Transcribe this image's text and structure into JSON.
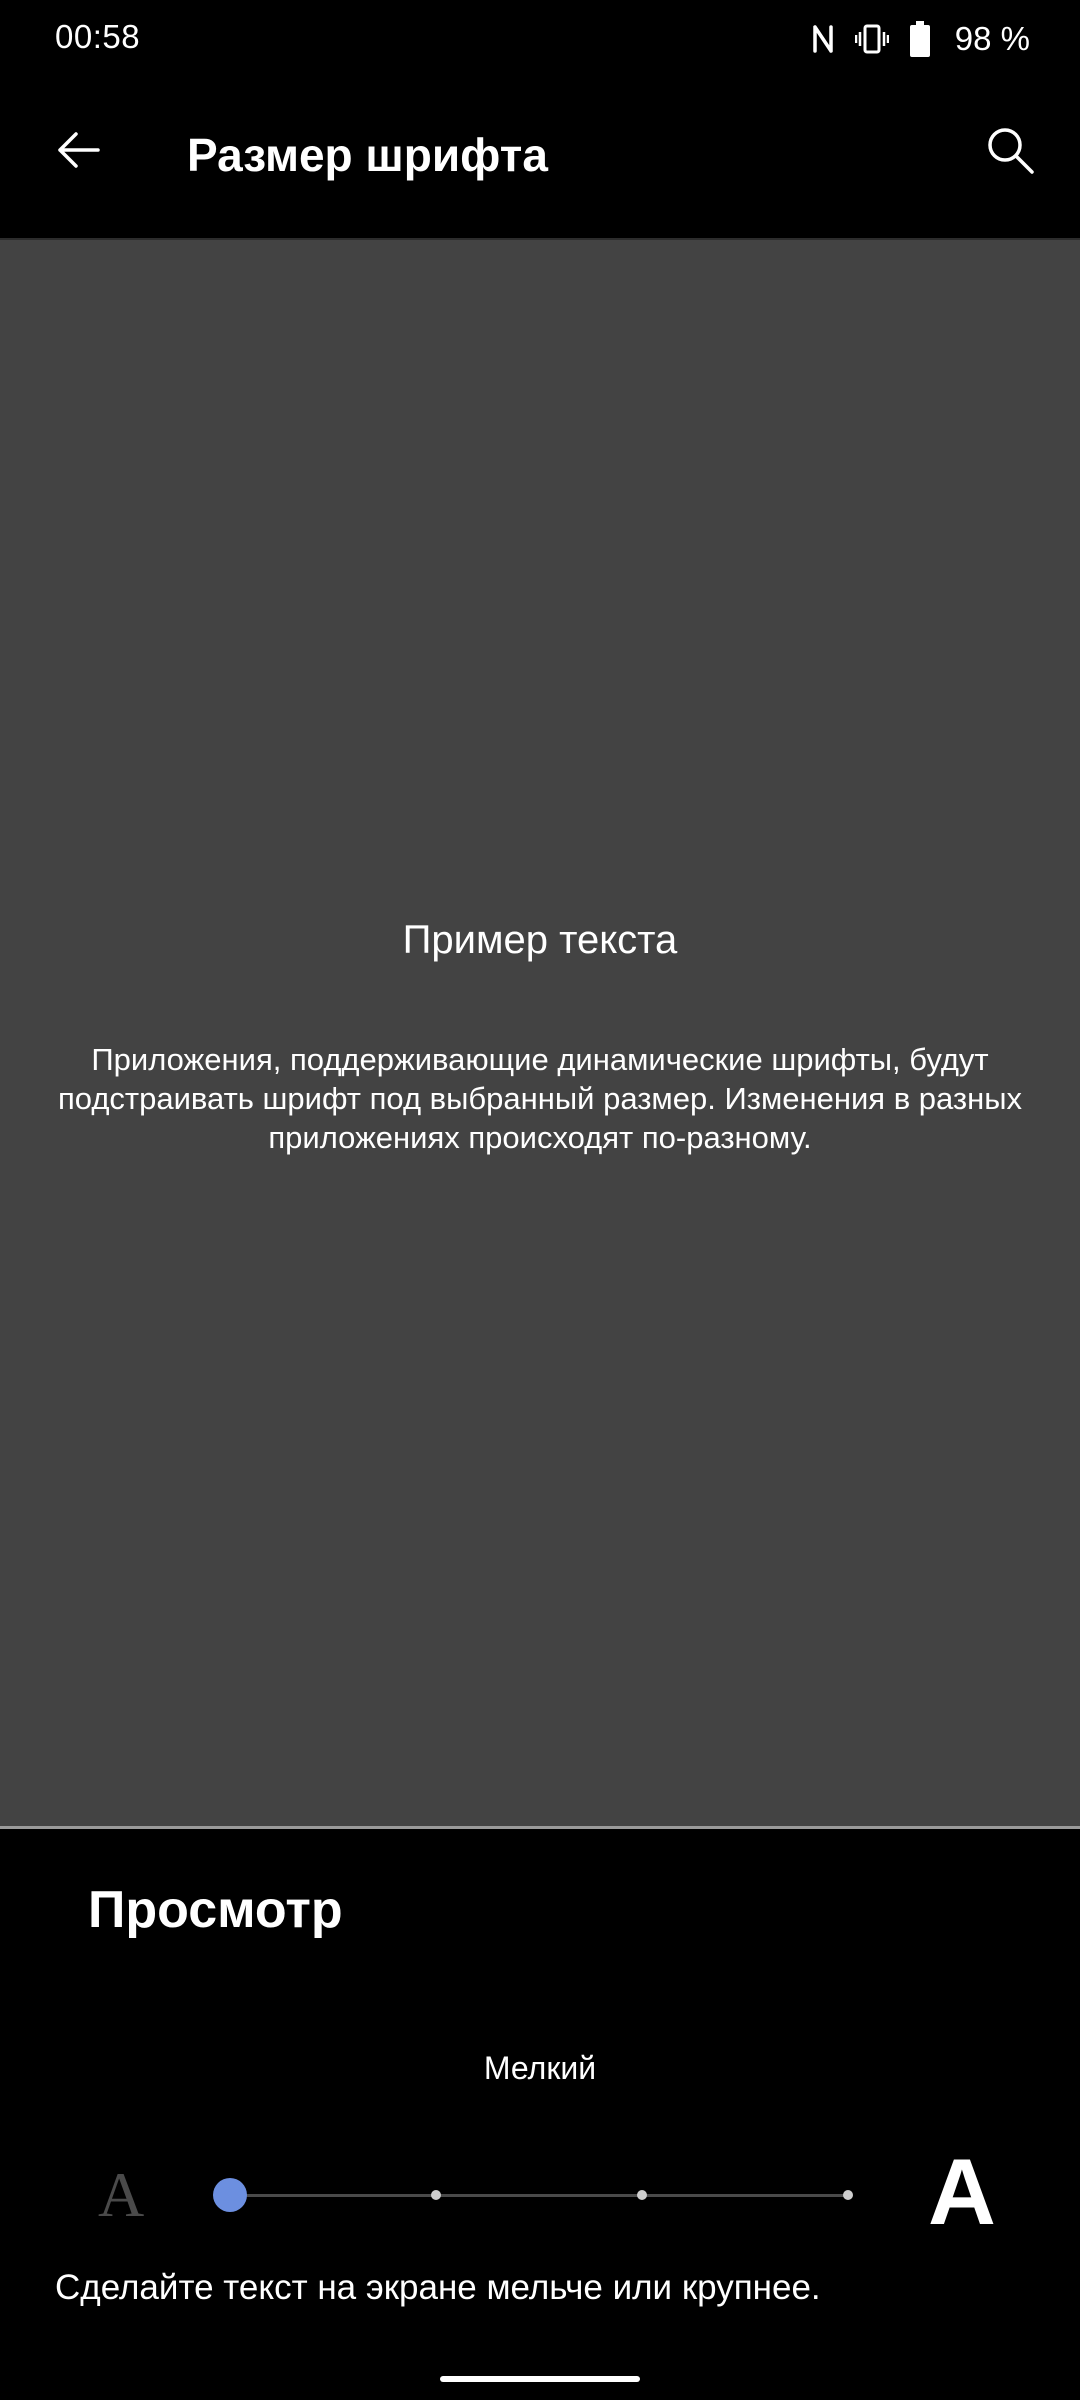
{
  "status_bar": {
    "time": "00:58",
    "battery_text": "98 %",
    "icons": [
      "nfc-icon",
      "vibrate-icon",
      "battery-icon"
    ]
  },
  "app_bar": {
    "title": "Размер шрифта",
    "back_icon": "arrow-left-icon",
    "search_icon": "search-icon"
  },
  "preview": {
    "heading": "Пример текста",
    "body": "Приложения, поддерживающие динамические шрифты, будут подстраивать шрифт под выбранный размер. Изменения в разных приложениях происходят по-разному."
  },
  "controls": {
    "section_title": "Просмотр",
    "size_label": "Мелкий",
    "small_glyph": "A",
    "large_glyph": "A",
    "slider": {
      "steps": 4,
      "selected_index": 0
    },
    "hint": "Сделайте текст на экране мельче или крупнее."
  },
  "colors": {
    "background": "#000000",
    "preview_background": "#434343",
    "accent": "#6c8fe0",
    "text": "#ffffff"
  }
}
